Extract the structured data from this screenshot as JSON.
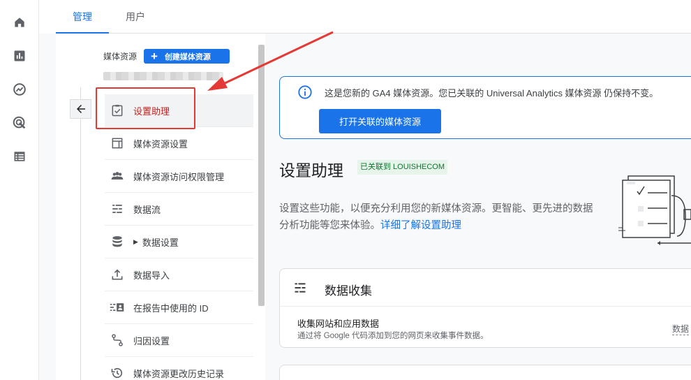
{
  "rail": {
    "icons": [
      "home-icon",
      "reports-icon",
      "explore-icon",
      "advertising-icon",
      "configure-icon"
    ]
  },
  "tabs": [
    {
      "label": "管理",
      "active": true
    },
    {
      "label": "用户",
      "active": false
    }
  ],
  "property": {
    "label": "媒体资源",
    "create_button": "创建媒体资源"
  },
  "menu": [
    {
      "label": "设置助理",
      "icon": "checklist-icon",
      "selected": true
    },
    {
      "label": "媒体资源设置",
      "icon": "property-settings-icon"
    },
    {
      "label": "媒体资源访问权限管理",
      "icon": "people-icon"
    },
    {
      "label": "数据流",
      "icon": "data-streams-icon"
    },
    {
      "label": "数据设置",
      "icon": "database-icon",
      "expandable": true
    },
    {
      "label": "数据导入",
      "icon": "upload-icon"
    },
    {
      "label": "在报告中使用的 ID",
      "icon": "reporting-id-icon"
    },
    {
      "label": "归因设置",
      "icon": "attribution-icon"
    },
    {
      "label": "媒体资源更改历史记录",
      "icon": "history-icon"
    }
  ],
  "notice": {
    "text": "这是您新的 GA4 媒体资源。您已关联的 Universal Analytics 媒体资源 仍保持不变。",
    "button": "打开关联的媒体资源"
  },
  "main": {
    "title": "设置助理",
    "badge": "已关联到 LOUISHECOM",
    "description": "设置这些功能，以便充分利用您的新媒体资源。更智能、更先进的数据分析功能等您来体验。",
    "link": "详细了解设置助理"
  },
  "card": {
    "title": "数据收集",
    "row_title": "收集网站和应用数据",
    "row_subtitle": "通过将 Google 代码添加到您的网页来收集事件数据。",
    "row_trunc": "数据"
  },
  "colors": {
    "accent": "#1a73e8",
    "annotation_red": "#e53935",
    "badge_bg": "#e6f4ea",
    "badge_text": "#137333"
  }
}
